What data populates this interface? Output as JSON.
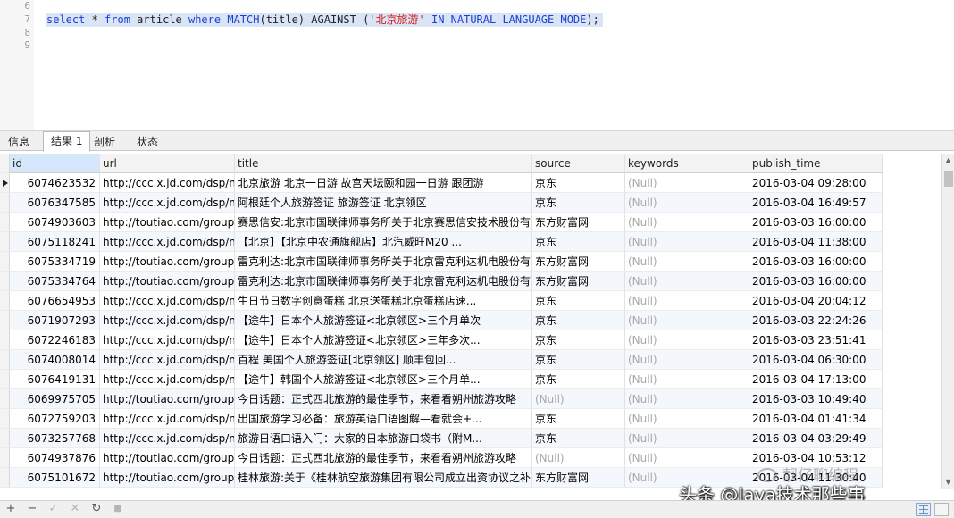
{
  "editor": {
    "line_numbers": [
      "6",
      "7",
      "8",
      "9"
    ],
    "code": {
      "t1": "select",
      "t2": " * ",
      "t3": "from",
      "t4": " article ",
      "t5": "where",
      "t6": " ",
      "t7": "MATCH",
      "t8": "(title) AGAINST (",
      "t9": "'北京旅游'",
      "t10": " ",
      "t11": "IN NATURAL LANGUAGE MODE",
      "t12": ");"
    }
  },
  "tabs": [
    {
      "label": "信息",
      "active": false
    },
    {
      "label": "结果 1",
      "active": true
    },
    {
      "label": "剖析",
      "active": false
    },
    {
      "label": "状态",
      "active": false
    }
  ],
  "grid": {
    "columns": [
      "id",
      "url",
      "title",
      "source",
      "keywords",
      "publish_time"
    ],
    "rows": [
      [
        "6074623532",
        "http://ccc.x.jd.com/dsp/nc",
        "北京旅游 北京一日游 故宫天坛颐和园一日游 跟团游",
        "京东",
        "(Null)",
        "2016-03-04 09:28:00"
      ],
      [
        "6076347585",
        "http://ccc.x.jd.com/dsp/nc",
        "阿根廷个人旅游签证 旅游签证 北京领区",
        "京东",
        "(Null)",
        "2016-03-04 16:49:57"
      ],
      [
        "6074903603",
        "http://toutiao.com/group/",
        "赛思信安:北京市国联律师事务所关于北京赛思信安技术股份有限",
        "东方财富网",
        "(Null)",
        "2016-03-03 16:00:00"
      ],
      [
        "6075118241",
        "http://ccc.x.jd.com/dsp/nc",
        "【北京】【北京中农通旗舰店】北汽威旺M20 ...",
        "京东",
        "(Null)",
        "2016-03-04 11:38:00"
      ],
      [
        "6075334719",
        "http://toutiao.com/group/",
        "雷克利达:北京市国联律师事务所关于北京雷克利达机电股份有",
        "东方财富网",
        "(Null)",
        "2016-03-03 16:00:00"
      ],
      [
        "6075334764",
        "http://toutiao.com/group/",
        "雷克利达:北京市国联律师事务所关于北京雷克利达机电股份有",
        "东方财富网",
        "(Null)",
        "2016-03-03 16:00:00"
      ],
      [
        "6076654953",
        "http://ccc.x.jd.com/dsp/nc",
        "生日节日数字创意蛋糕 北京送蛋糕北京蛋糕店速...",
        "京东",
        "(Null)",
        "2016-03-04 20:04:12"
      ],
      [
        "6071907293",
        "http://ccc.x.jd.com/dsp/nc",
        "【途牛】日本个人旅游签证<北京领区>三个月单次",
        "京东",
        "(Null)",
        "2016-03-03 22:24:26"
      ],
      [
        "6072246183",
        "http://ccc.x.jd.com/dsp/nc",
        "【途牛】日本个人旅游签证<北京领区>三年多次...",
        "京东",
        "(Null)",
        "2016-03-03 23:51:41"
      ],
      [
        "6074008014",
        "http://ccc.x.jd.com/dsp/nc",
        "百程 美国个人旅游签证[北京领区] 顺丰包回...",
        "京东",
        "(Null)",
        "2016-03-04 06:30:00"
      ],
      [
        "6076419131",
        "http://ccc.x.jd.com/dsp/nc",
        "【途牛】韩国个人旅游签证<北京领区>三个月单...",
        "京东",
        "(Null)",
        "2016-03-04 17:13:00"
      ],
      [
        "6069975705",
        "http://toutiao.com/group/",
        "今日话题：正式西北旅游的最佳季节，来看看朔州旅游攻略",
        "(Null)",
        "(Null)",
        "2016-03-03 10:49:40"
      ],
      [
        "6072759203",
        "http://ccc.x.jd.com/dsp/nc",
        "出国旅游学习必备：旅游英语口语图解—看就会+...",
        "京东",
        "(Null)",
        "2016-03-04 01:41:34"
      ],
      [
        "6073257768",
        "http://ccc.x.jd.com/dsp/nc",
        "旅游日语口语入门：大家的日本旅游口袋书（附M...",
        "京东",
        "(Null)",
        "2016-03-04 03:29:49"
      ],
      [
        "6074937876",
        "http://toutiao.com/group/",
        "今日话题：正式西北旅游的最佳季节，来看看朔州旅游攻略",
        "(Null)",
        "(Null)",
        "2016-03-04 10:53:12"
      ],
      [
        "6075101672",
        "http://toutiao.com/group/",
        "桂林旅游:关于《桂林航空旅游集团有限公司成立出资协议之补",
        "东方财富网",
        "(Null)",
        "2016-03-04 11:30:40"
      ]
    ]
  },
  "toolbar": {
    "add": "+",
    "remove": "−",
    "apply": "✓",
    "discard": "✕",
    "refresh": "↻",
    "stop": "■"
  },
  "watermark": {
    "line1": "靓仔聊编程",
    "line2": "头条 @Java技术那些事"
  },
  "colors": {
    "keyword": "#1a3fd1",
    "string": "#d8201a",
    "selection": "#d9e5f7",
    "null_text": "#a8a8a8"
  }
}
